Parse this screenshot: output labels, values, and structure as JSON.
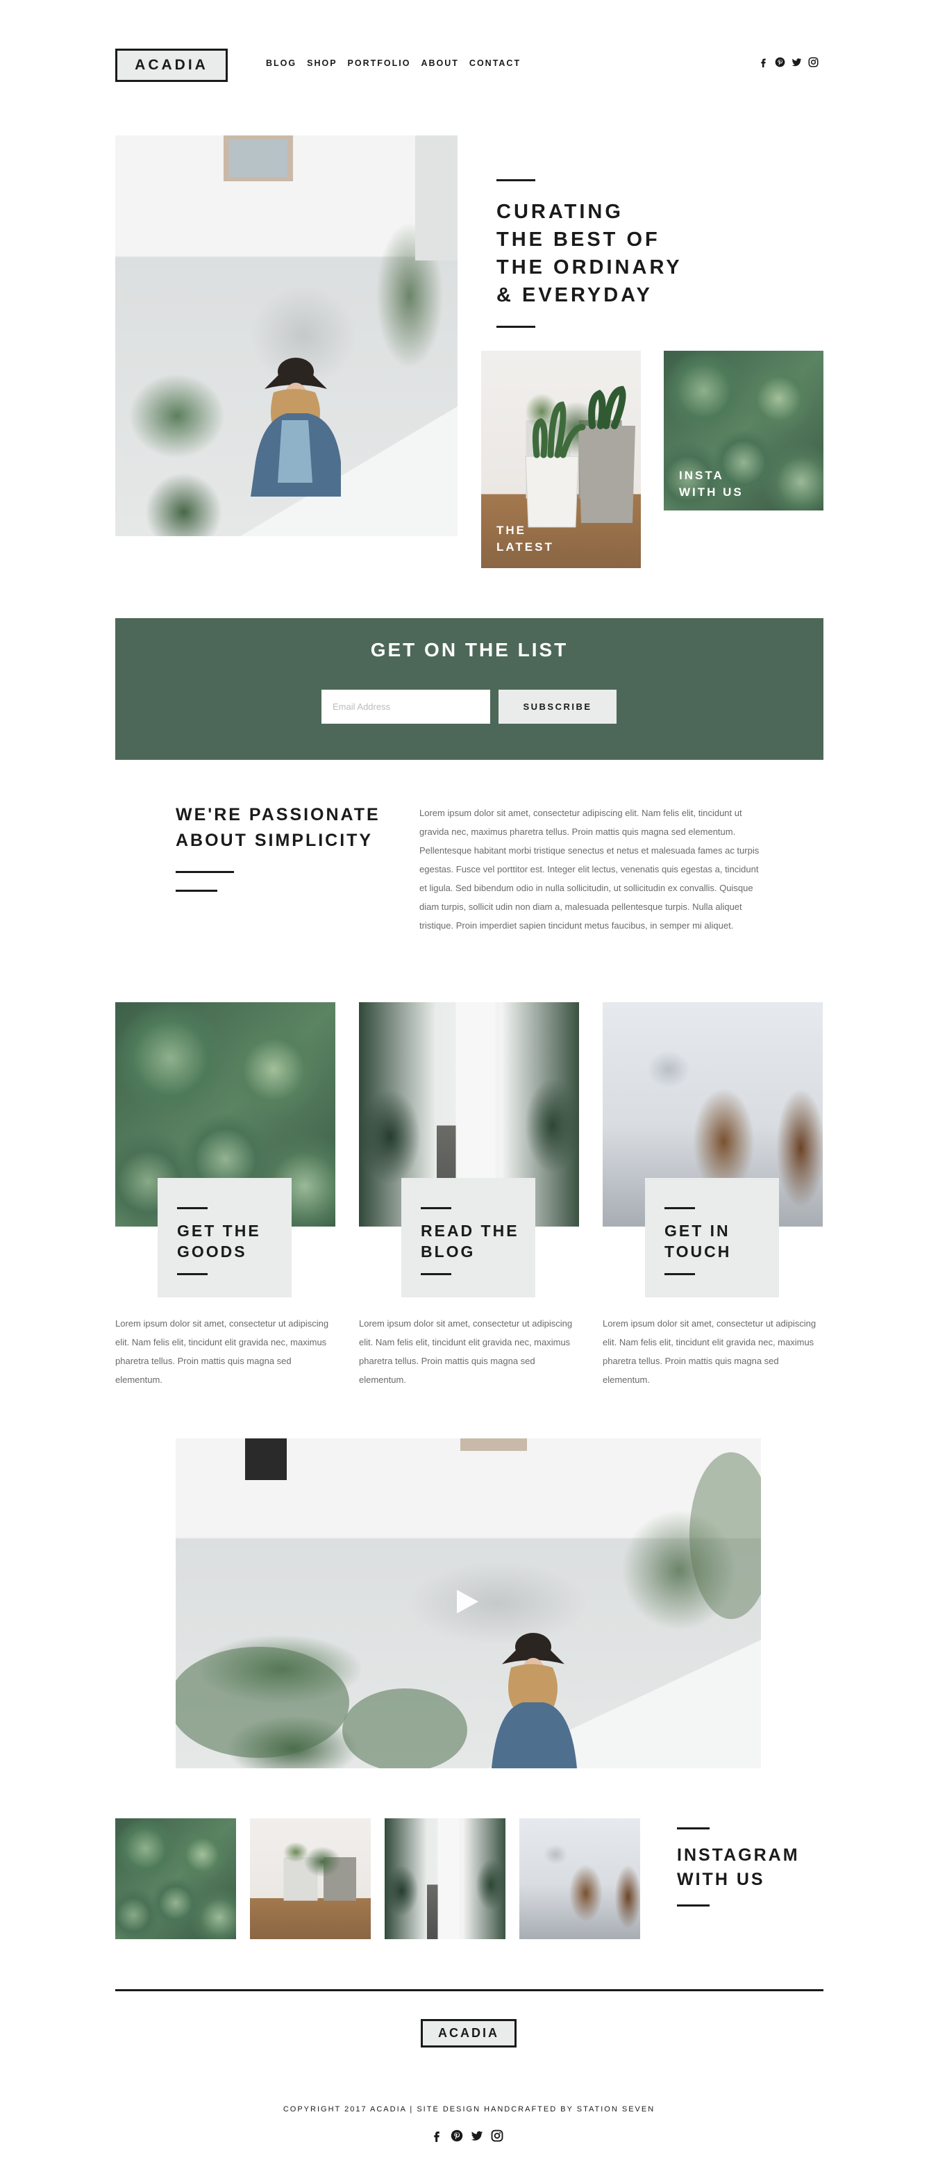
{
  "brand": {
    "logo": "ACADIA"
  },
  "nav": {
    "items": [
      "BLOG",
      "SHOP",
      "PORTFOLIO",
      "ABOUT",
      "CONTACT"
    ]
  },
  "social": {
    "icons": [
      "facebook-icon",
      "pinterest-icon",
      "twitter-icon",
      "instagram-icon"
    ]
  },
  "hero": {
    "title_lines": [
      "CURATING",
      "THE BEST OF",
      "THE ORDINARY",
      "& EVERYDAY"
    ],
    "tiles": [
      {
        "label_lines": [
          "THE",
          "LATEST"
        ]
      },
      {
        "label_lines": [
          "INSTA",
          "WITH US"
        ]
      }
    ]
  },
  "newsletter": {
    "title": "GET ON THE LIST",
    "email_placeholder": "Email Address",
    "subscribe_label": "SUBSCRIBE"
  },
  "about": {
    "title_lines": [
      "WE'RE PASSIONATE",
      "ABOUT SIMPLICITY"
    ],
    "body": "Lorem ipsum dolor sit amet, consectetur adipiscing elit. Nam felis elit, tincidunt ut gravida nec, maximus pharetra tellus. Proin mattis quis magna sed elementum. Pellentesque habitant morbi tristique senectus et netus et malesuada fames ac turpis egestas. Fusce vel porttitor est. Integer elit lectus, venenatis quis egestas a, tincidunt et ligula. Sed bibendum odio in nulla sollicitudin, ut sollicitudin ex convallis. Quisque diam turpis, sollicit udin non diam a, malesuada pellentesque turpis. Nulla aliquet tristique. Proin imperdiet sapien tincidunt metus faucibus, in semper mi aliquet."
  },
  "features": [
    {
      "title_lines": [
        "GET THE",
        "GOODS"
      ],
      "body": "Lorem ipsum dolor sit amet, consectetur ut adipiscing elit. Nam felis elit, tincidunt elit gravida nec, maximus pharetra tellus. Proin mattis quis magna sed elementum."
    },
    {
      "title_lines": [
        "READ THE",
        "BLOG"
      ],
      "body": "Lorem ipsum dolor sit amet, consectetur ut adipiscing elit. Nam felis elit, tincidunt elit gravida nec, maximus pharetra tellus. Proin mattis quis magna sed elementum."
    },
    {
      "title_lines": [
        "GET IN",
        "TOUCH"
      ],
      "body": "Lorem ipsum dolor sit amet, consectetur ut adipiscing elit. Nam felis elit, tincidunt elit gravida nec, maximus pharetra tellus. Proin mattis quis magna sed elementum."
    }
  ],
  "instagram": {
    "title_lines": [
      "INSTAGRAM",
      "WITH US"
    ]
  },
  "footer": {
    "logo": "ACADIA",
    "copyright": "COPYRIGHT 2017 ACADIA | SITE DESIGN HANDCRAFTED BY STATION SEVEN"
  },
  "colors": {
    "accent_green": "#4d6858",
    "light_gray": "#e9ecea",
    "text_dark": "#1a1a1a",
    "text_muted": "#6a6a6a"
  }
}
